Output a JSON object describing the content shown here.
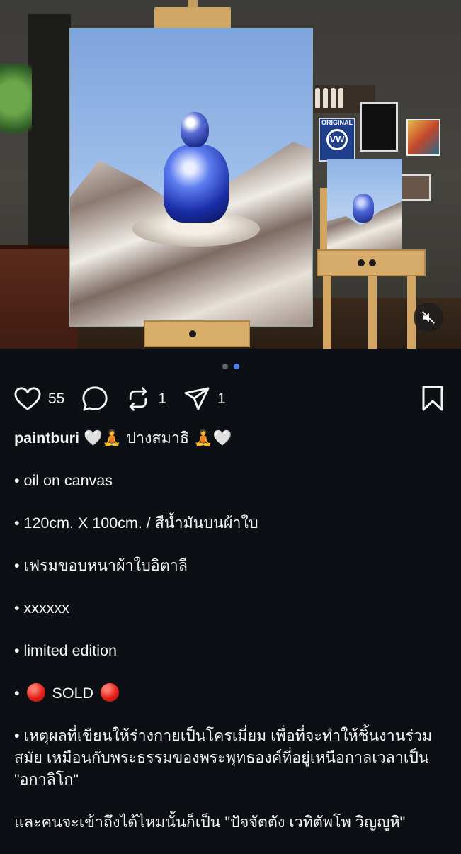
{
  "post": {
    "image_dots": 2,
    "active_dot": 2
  },
  "media": {
    "vw_sign_text": "ORIGINAL",
    "vw_logo_text": "VW",
    "mute_icon": "speaker-muted-icon"
  },
  "actions": {
    "like_icon": "heart-icon",
    "likes": "55",
    "comment_icon": "speech-bubble-icon",
    "repost_icon": "repost-icon",
    "reposts": "1",
    "share_icon": "paper-plane-icon",
    "shares": "1",
    "save_icon": "bookmark-icon"
  },
  "caption": {
    "username": "paintburi",
    "heading": "🤍🧘 ปางสมาธิ 🧘🤍",
    "lines": [
      "• oil on canvas",
      "• 120cm. X 100cm. / สีน้ำมันบนผ้าใบ",
      "• เฟรมขอบหนาผ้าใบอิตาลี",
      "• xxxxxx",
      "• limited edition",
      "SOLD"
    ],
    "sold_bullet": "•",
    "paragraph": "• เหตุผลที่เขียนให้ร่างกายเป็นโครเมี่ยม เพื่อที่จะทำให้ชิ้นงานร่วมสมัย เหมือนกับพระธรรมของพระพุทธองค์ที่อยู่เหนือกาลเวลาเป็น \"อกาลิโก\"",
    "closing": "และคนจะเข้าถึงได้ไหมนั้นก็เป็น \"ปัจจัตตัง เวทิตัพโพ วิญญูหิ\""
  },
  "colors": {
    "background": "#0c1014",
    "text": "#f5f5f5",
    "active_dot": "#4f7cf6",
    "inactive_dot": "#5e6670",
    "sold_dot": "#e3211a"
  }
}
